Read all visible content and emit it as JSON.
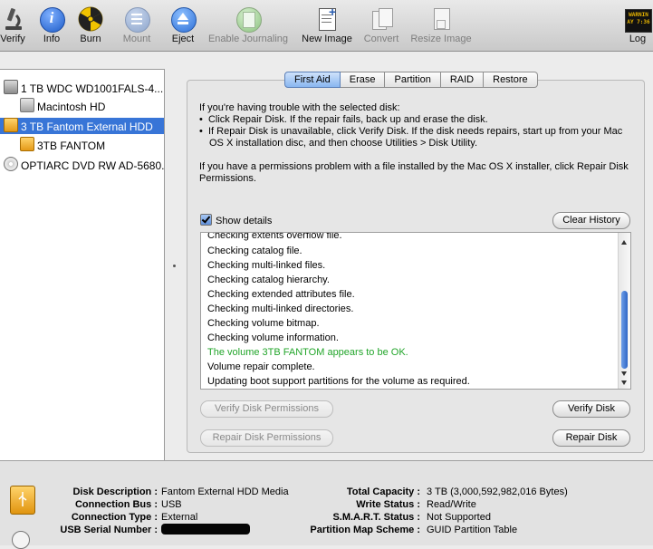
{
  "toolbar": {
    "items": [
      {
        "label": "Verify",
        "icon": "microscope-icon",
        "enabled": true
      },
      {
        "label": "Info",
        "icon": "info-icon",
        "enabled": true
      },
      {
        "label": "Burn",
        "icon": "burn-icon",
        "enabled": true
      },
      {
        "label": "Mount",
        "icon": "mount-icon",
        "enabled": false
      },
      {
        "label": "Eject",
        "icon": "eject-icon",
        "enabled": true
      },
      {
        "label": "Enable Journaling",
        "icon": "journaling-icon",
        "enabled": false
      },
      {
        "label": "New Image",
        "icon": "new-image-icon",
        "enabled": true
      },
      {
        "label": "Convert",
        "icon": "convert-icon",
        "enabled": false
      },
      {
        "label": "Resize Image",
        "icon": "resize-image-icon",
        "enabled": false
      },
      {
        "label": "Log",
        "icon": "log-icon",
        "enabled": true
      }
    ],
    "log_icon_text": [
      "WARNIN",
      "AY 7:36"
    ]
  },
  "sidebar": {
    "items": [
      {
        "label": "1 TB WDC WD1001FALS-4...",
        "level": 0,
        "type": "hdd"
      },
      {
        "label": "Macintosh HD",
        "level": 1,
        "type": "volume"
      },
      {
        "label": "3 TB Fantom External HDD",
        "level": 0,
        "type": "external",
        "selected": true
      },
      {
        "label": "3TB FANTOM",
        "level": 1,
        "type": "volume-external"
      },
      {
        "label": "OPTIARC DVD RW AD-5680...",
        "level": 0,
        "type": "dvd"
      }
    ]
  },
  "tabs": [
    {
      "label": "First Aid",
      "active": true
    },
    {
      "label": "Erase",
      "active": false
    },
    {
      "label": "Partition",
      "active": false
    },
    {
      "label": "RAID",
      "active": false
    },
    {
      "label": "Restore",
      "active": false
    }
  ],
  "first_aid": {
    "intro": "If you're having trouble with the selected disk:",
    "bullet1": "Click Repair Disk. If the repair fails, back up and erase the disk.",
    "bullet2": "If Repair Disk is unavailable, click Verify Disk. If the disk needs repairs, start up from your Mac OS X installation disc, and then choose Utilities > Disk Utility.",
    "permissions_note": "If you have a permissions problem with a file installed by the Mac OS X installer, click Repair Disk Permissions.",
    "show_details_label": "Show details",
    "show_details_checked": true,
    "clear_history_label": "Clear History",
    "log_lines": [
      {
        "text": "Checking extents overflow file.",
        "status": "normal"
      },
      {
        "text": "Checking catalog file.",
        "status": "normal"
      },
      {
        "text": "Checking multi-linked files.",
        "status": "normal"
      },
      {
        "text": "Checking catalog hierarchy.",
        "status": "normal"
      },
      {
        "text": "Checking extended attributes file.",
        "status": "normal"
      },
      {
        "text": "Checking multi-linked directories.",
        "status": "normal"
      },
      {
        "text": "Checking volume bitmap.",
        "status": "normal"
      },
      {
        "text": "Checking volume information.",
        "status": "normal"
      },
      {
        "text": "The volume 3TB FANTOM appears to be OK.",
        "status": "ok"
      },
      {
        "text": "Volume repair complete.",
        "status": "normal"
      },
      {
        "text": "Updating boot support partitions for the volume as required.",
        "status": "normal"
      }
    ],
    "verify_permissions_label": "Verify Disk Permissions",
    "repair_permissions_label": "Repair Disk Permissions",
    "verify_disk_label": "Verify Disk",
    "repair_disk_label": "Repair Disk"
  },
  "info": {
    "left": [
      {
        "label": "Disk Description :",
        "value": "Fantom External HDD Media"
      },
      {
        "label": "Connection Bus :",
        "value": "USB"
      },
      {
        "label": "Connection Type :",
        "value": "External"
      },
      {
        "label": "USB Serial Number :",
        "value": ""
      }
    ],
    "right": [
      {
        "label": "Total Capacity :",
        "value": "3 TB (3,000,592,982,016 Bytes)"
      },
      {
        "label": "Write Status :",
        "value": "Read/Write"
      },
      {
        "label": "S.M.A.R.T. Status :",
        "value": "Not Supported"
      },
      {
        "label": "Partition Map Scheme :",
        "value": "GUID Partition Table"
      }
    ]
  },
  "colors": {
    "selection": "#3875d7",
    "ok_text": "#22a52a",
    "active_tab": "#89b6f0"
  }
}
